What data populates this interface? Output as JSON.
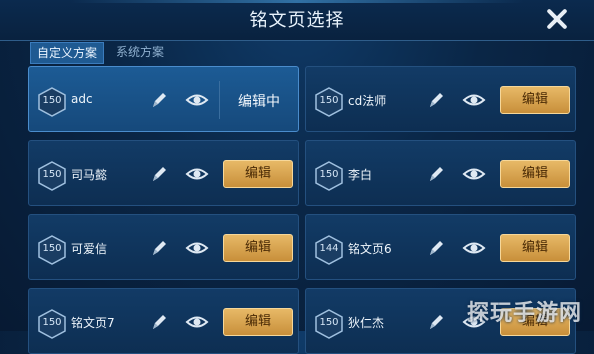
{
  "header": {
    "title": "铭文页选择"
  },
  "tabs": [
    {
      "label": "自定义方案",
      "active": true
    },
    {
      "label": "系统方案",
      "active": false
    }
  ],
  "pages": [
    {
      "level": "150",
      "name": "adc",
      "state": "编辑中",
      "selected": true
    },
    {
      "level": "150",
      "name": "cd法师",
      "button": "编辑"
    },
    {
      "level": "150",
      "name": "司马懿",
      "button": "编辑"
    },
    {
      "level": "150",
      "name": "李白",
      "button": "编辑"
    },
    {
      "level": "150",
      "name": "可爱信",
      "button": "编辑"
    },
    {
      "level": "144",
      "name": "铭文页6",
      "button": "编辑"
    },
    {
      "level": "150",
      "name": "铭文页7",
      "button": "编辑"
    },
    {
      "level": "150",
      "name": "狄仁杰",
      "button": "编辑"
    }
  ],
  "icons": {
    "close": "close-icon",
    "level": "hexagon-level-badge",
    "rename": "pencil-icon",
    "view": "eye-icon"
  },
  "watermark": "探玩手游网",
  "colors": {
    "button": "#d9a452",
    "selected_card": "#1c5b95",
    "card": "#123b66"
  }
}
